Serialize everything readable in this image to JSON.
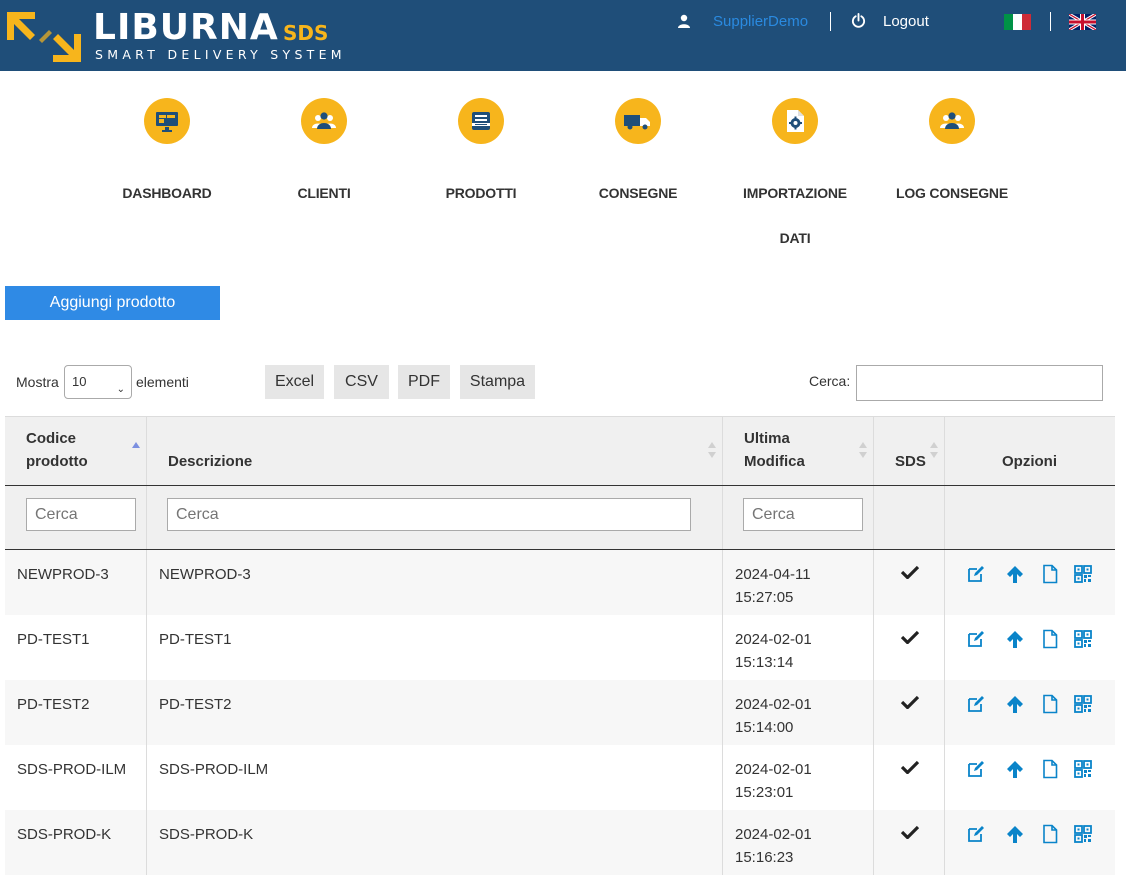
{
  "header": {
    "brand": "LIBURNA",
    "brand_suffix": "SDS",
    "tagline": "SMART DELIVERY SYSTEM",
    "user": "SupplierDemo",
    "logout": "Logout",
    "user_icon": "user-icon",
    "power_icon": "power-icon",
    "languages": [
      "it",
      "en"
    ]
  },
  "nav": [
    {
      "label": "DASHBOARD",
      "icon": "dashboard-icon"
    },
    {
      "label": "CLIENTI",
      "icon": "users-icon"
    },
    {
      "label": "PRODOTTI",
      "icon": "products-icon"
    },
    {
      "label": "CONSEGNE",
      "icon": "truck-icon"
    },
    {
      "label": "IMPORTAZIONE",
      "label2": "DATI",
      "icon": "import-icon"
    },
    {
      "label": "LOG CONSEGNE",
      "icon": "users-icon"
    }
  ],
  "add_button": "Aggiungi prodotto",
  "controls": {
    "show_label": "Mostra",
    "page_size": "10",
    "elements_label": "elementi",
    "export_buttons": [
      "Excel",
      "CSV",
      "PDF",
      "Stampa"
    ],
    "search_label": "Cerca:",
    "search_value": ""
  },
  "table": {
    "columns": [
      {
        "line1": "Codice",
        "line2": "prodotto",
        "sort": "asc"
      },
      {
        "line1": "",
        "line2": "Descrizione",
        "sort": "both"
      },
      {
        "line1": "Ultima",
        "line2": "Modifica",
        "sort": "both"
      },
      {
        "line1": "",
        "line2": "SDS",
        "sort": "both"
      },
      {
        "line1": "",
        "line2": "Opzioni",
        "sort": "none"
      }
    ],
    "filter_placeholder": "Cerca",
    "rows": [
      {
        "code": "NEWPROD-3",
        "description": "NEWPROD-3",
        "date": "2024-04-11",
        "time": "15:27:05",
        "sds": true
      },
      {
        "code": "PD-TEST1",
        "description": "PD-TEST1",
        "date": "2024-02-01",
        "time": "15:13:14",
        "sds": true
      },
      {
        "code": "PD-TEST2",
        "description": "PD-TEST2",
        "date": "2024-02-01",
        "time": "15:14:00",
        "sds": true
      },
      {
        "code": "SDS-PROD-ILM",
        "description": "SDS-PROD-ILM",
        "date": "2024-02-01",
        "time": "15:23:01",
        "sds": true
      },
      {
        "code": "SDS-PROD-K",
        "description": "SDS-PROD-K",
        "date": "2024-02-01",
        "time": "15:16:23",
        "sds": true
      }
    ],
    "row_actions": [
      "edit-icon",
      "upload-icon",
      "document-icon",
      "qr-code-icon"
    ]
  },
  "colors": {
    "header_bg": "#1f4e79",
    "accent": "#f7b51c",
    "primary": "#2f8ae5",
    "link": "#0a84c9"
  }
}
